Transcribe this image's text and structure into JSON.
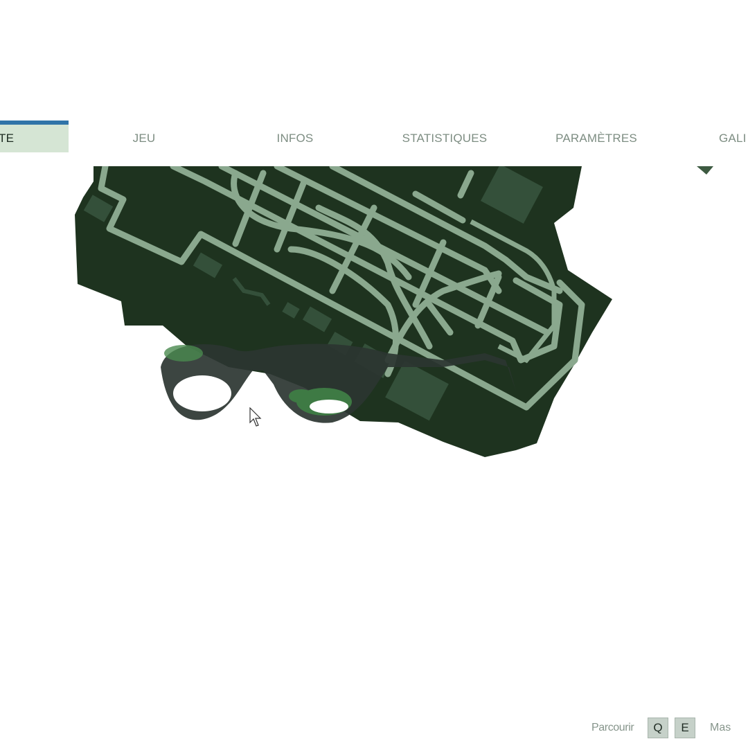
{
  "tabs": {
    "active": "TE",
    "jeu": "JEU",
    "infos": "INFOS",
    "stats": "STATISTIQUES",
    "params": "PARAMÈTRES",
    "gal": "GALI"
  },
  "hints": {
    "browse": "Parcourir",
    "key_prev": "Q",
    "key_next": "E",
    "more": "Mas"
  },
  "colors": {
    "active_tab_bg": "#d5e5d4",
    "active_tab_border": "#3074a8",
    "map_land": "#1e331f",
    "map_roads": "#8aa88e"
  }
}
